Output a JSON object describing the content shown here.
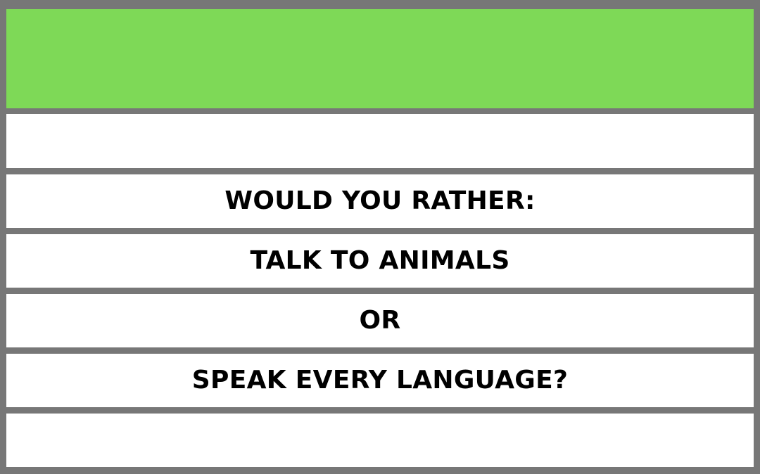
{
  "colors": {
    "header_fill": "#7ed957",
    "frame": "#777777",
    "row_fill": "#ffffff",
    "text": "#000000"
  },
  "prompt": {
    "heading": "WOULD YOU RATHER:",
    "option_a": "TALK TO ANIMALS",
    "separator": "OR",
    "option_b": "SPEAK EVERY LANGUAGE?"
  }
}
